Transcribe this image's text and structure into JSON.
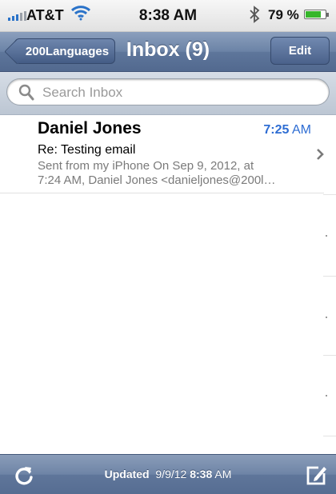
{
  "status_bar": {
    "carrier": "AT&T",
    "time": "8:38 AM",
    "battery_percent": "79 %",
    "battery_level": 0.79,
    "icons": [
      "signal-icon",
      "wifi-icon",
      "bluetooth-icon",
      "battery-icon"
    ]
  },
  "nav": {
    "back_label": "200Languages",
    "title": "Inbox (9)",
    "edit_label": "Edit"
  },
  "search": {
    "placeholder": "Search Inbox"
  },
  "messages": [
    {
      "sender": "Daniel Jones",
      "time_value": "7:25",
      "time_suffix": " AM",
      "subject": "Re: Testing email",
      "preview_line1": "Sent from my iPhone On Sep 9, 2012, at",
      "preview_line2": "7:24 AM, Daniel Jones <danieljones@200l…"
    }
  ],
  "toolbar": {
    "updated_label": "Updated",
    "updated_date": "9/9/12",
    "updated_time_value": "8:38",
    "updated_time_suffix": " AM"
  },
  "colors": {
    "accent_blue": "#2e6dd3",
    "nav_bar": "#6b83a6",
    "battery_green": "#36b62b"
  }
}
